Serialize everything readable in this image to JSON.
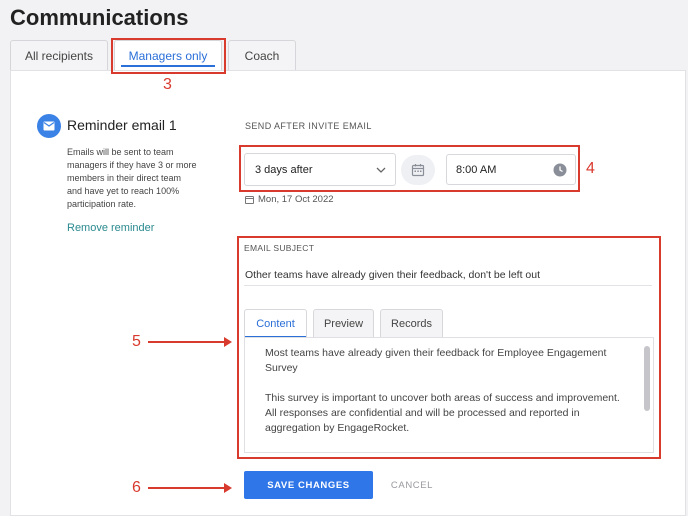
{
  "page": {
    "title": "Communications"
  },
  "tabs": [
    {
      "label": "All recipients"
    },
    {
      "label": "Managers only"
    },
    {
      "label": "Coach"
    }
  ],
  "reminder": {
    "title": "Reminder email 1",
    "description": "Emails will be sent to team managers if they have 3 or more members in their direct team and have yet to reach 100% participation rate.",
    "remove_label": "Remove reminder"
  },
  "schedule": {
    "label": "SEND AFTER INVITE EMAIL",
    "delay_value": "3 days after",
    "time_value": "8:00 AM",
    "date_text": "Mon, 17 Oct 2022"
  },
  "email": {
    "subject_label": "EMAIL SUBJECT",
    "subject_value": "Other teams have already given their feedback, don't be left out",
    "content_tabs": [
      {
        "label": "Content"
      },
      {
        "label": "Preview"
      },
      {
        "label": "Records"
      }
    ],
    "body": {
      "p1": "Most teams have already given their feedback for Employee Engagement Survey",
      "p2": "This survey is important to uncover both areas of success and improvement.",
      "p3": "All responses are confidential and will be processed and reported in aggregation by EngageRocket."
    }
  },
  "actions": {
    "save_label": "SAVE CHANGES",
    "cancel_label": "CANCEL"
  },
  "annotations": {
    "n3": "3",
    "n4": "4",
    "n5": "5",
    "n6": "6"
  },
  "colors": {
    "accent": "#2f76e8",
    "annotation": "#d93a2e",
    "link": "#2a8a8f"
  }
}
